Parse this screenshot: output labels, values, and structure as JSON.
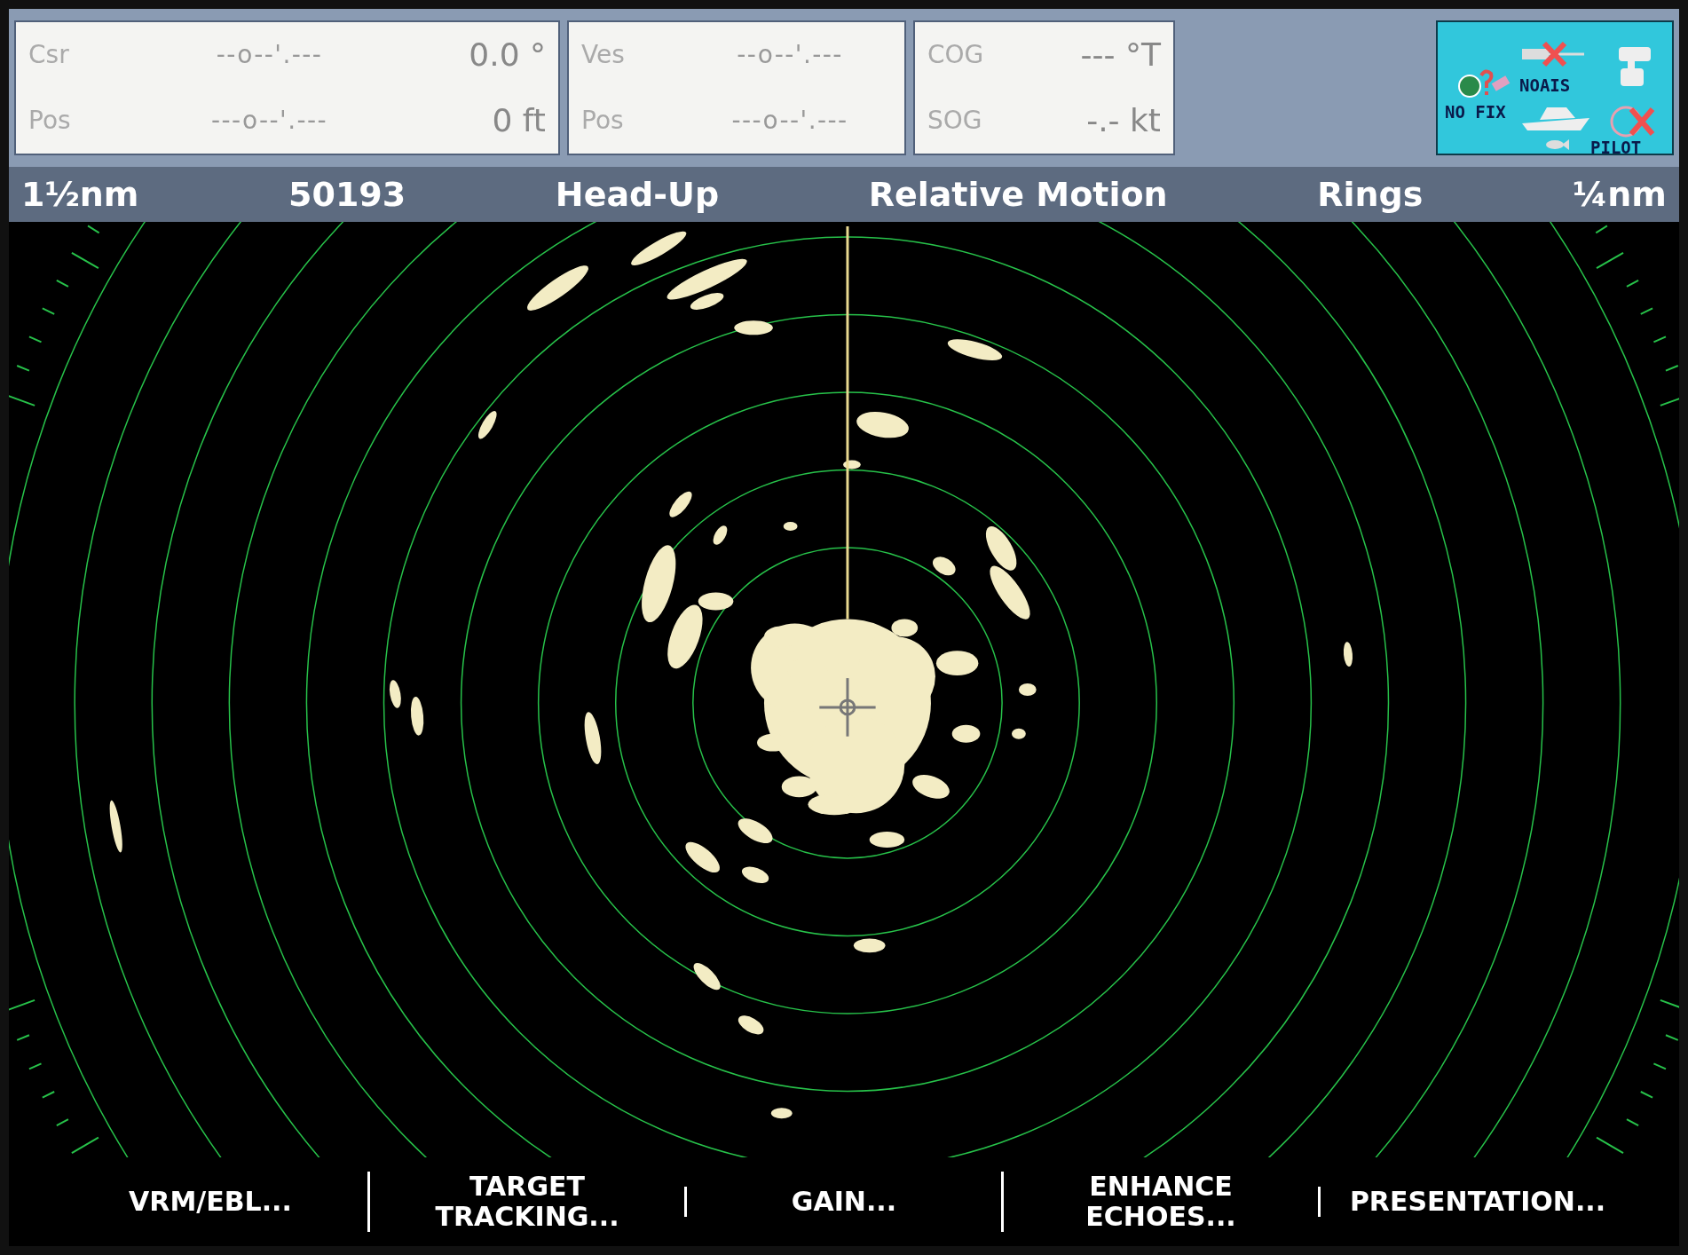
{
  "info_panels": [
    {
      "rows": [
        {
          "label": "Csr",
          "position": "--o--'.---",
          "value": "0.0 °"
        },
        {
          "label": "Pos",
          "position": "---o--'.---",
          "value": "0 ft"
        }
      ]
    },
    {
      "rows": [
        {
          "label": "Ves",
          "position": "--o--'.---"
        },
        {
          "label": "Pos",
          "position": "---o--'.---"
        }
      ]
    },
    {
      "rows": [
        {
          "label": "COG",
          "value": "--- °T"
        },
        {
          "label": "SOG",
          "value": "-.- kt"
        }
      ]
    }
  ],
  "status_icons": {
    "no_fix": "NO FIX",
    "no_ais": "NOAIS",
    "pilot": "PILOT"
  },
  "status_bar": [
    "1½nm",
    "50193",
    "Head-Up",
    "Relative Motion",
    "Rings",
    "¼nm"
  ],
  "softkeys": [
    {
      "lines": [
        "VRM/EBL..."
      ]
    },
    {
      "lines": [
        "TARGET",
        "TRACKING..."
      ]
    },
    {
      "lines": [
        "GAIN..."
      ]
    },
    {
      "lines": [
        "ENHANCE",
        "ECHOES..."
      ]
    },
    {
      "lines": [
        "PRESENTATION..."
      ]
    }
  ]
}
